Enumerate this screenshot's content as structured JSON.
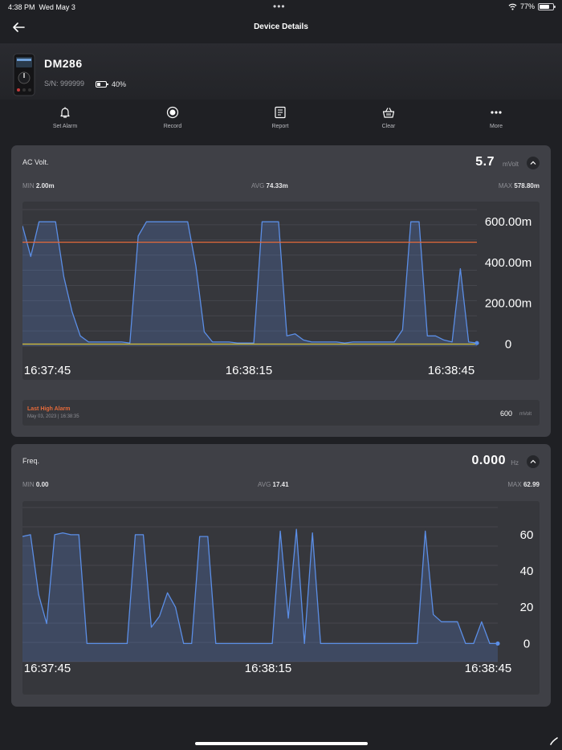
{
  "status_bar": {
    "time": "4:38 PM",
    "date": "Wed May 3",
    "battery": "77%"
  },
  "nav": {
    "title": "Device Details"
  },
  "device": {
    "name": "DM286",
    "serial": "S/N: 999999",
    "battery_percent": "40%",
    "battery_level": 0.4
  },
  "toolbar": [
    {
      "label": "Set Alarm",
      "icon": "bell-icon"
    },
    {
      "label": "Record",
      "icon": "record-icon"
    },
    {
      "label": "Report",
      "icon": "report-icon"
    },
    {
      "label": "Clear",
      "icon": "basket-icon"
    },
    {
      "label": "More",
      "icon": "more-icon"
    }
  ],
  "colors": {
    "line": "#5b8ee6",
    "alarm_high": "#e56a3a",
    "alarm_low": "#d8c23a",
    "card_bg": "#3f4046",
    "chart_bg": "#36373c",
    "page_bg": "#1f2024"
  },
  "ac_volt": {
    "title": "AC Volt.",
    "value": "5.7",
    "unit": "mVolt",
    "min_label": "MIN",
    "min_value": "2.00m",
    "avg_label": "AVG",
    "avg_value": "74.33m",
    "max_label": "MAX",
    "max_value": "578.80m",
    "alarm_title": "Last High Alarm",
    "alarm_date": "May 03, 2023 | 16:38:35",
    "alarm_value": "600",
    "alarm_unit": "mVolt"
  },
  "freq": {
    "title": "Freq.",
    "value": "0.000",
    "unit": "Hz",
    "min_label": "MIN",
    "min_value": "0.00",
    "avg_label": "AVG",
    "avg_value": "17.41",
    "max_label": "MAX",
    "max_value": "62.99"
  },
  "chart_data": [
    {
      "type": "area",
      "ylabels": [
        "600.00m",
        "400.00m",
        "200.00m",
        "0"
      ],
      "yticks": [
        600,
        400,
        200,
        0
      ],
      "ylim": [
        -10,
        660
      ],
      "xlabels": [
        "16:37:45",
        "16:38:15",
        "16:38:45"
      ],
      "grid": true,
      "thresholds": [
        {
          "name": "high",
          "value": 500,
          "color": "#e56a3a"
        },
        {
          "name": "low",
          "value": 0,
          "color": "#d8c23a"
        }
      ],
      "series": [
        {
          "values": [
            580,
            430,
            600,
            600,
            600,
            330,
            160,
            40,
            10,
            10,
            10,
            10,
            10,
            5,
            530,
            600,
            600,
            600,
            600,
            600,
            600,
            380,
            60,
            10,
            10,
            10,
            5,
            5,
            5,
            600,
            600,
            600,
            40,
            50,
            20,
            10,
            10,
            10,
            10,
            5,
            10,
            10,
            10,
            10,
            10,
            10,
            70,
            600,
            600,
            40,
            40,
            20,
            10,
            370,
            10,
            5
          ]
        }
      ]
    },
    {
      "type": "area",
      "ylabels": [
        "60",
        "40",
        "20",
        "0"
      ],
      "yticks": [
        60,
        40,
        20,
        0
      ],
      "ylim": [
        -10,
        75
      ],
      "xlabels": [
        "16:37:45",
        "16:38:15",
        "16:38:45"
      ],
      "grid": true,
      "series": [
        {
          "values": [
            59,
            60,
            27,
            11,
            60,
            61,
            60,
            60,
            0,
            0,
            0,
            0,
            0,
            0,
            60,
            60,
            9,
            15,
            28,
            20,
            0,
            0,
            59,
            59,
            0,
            0,
            0,
            0,
            0,
            0,
            0,
            0,
            62,
            14,
            63,
            0,
            61,
            0,
            0,
            0,
            0,
            0,
            0,
            0,
            0,
            0,
            0,
            0,
            0,
            0,
            62,
            16,
            12,
            12,
            12,
            0,
            0,
            12,
            0,
            0
          ]
        }
      ]
    }
  ]
}
